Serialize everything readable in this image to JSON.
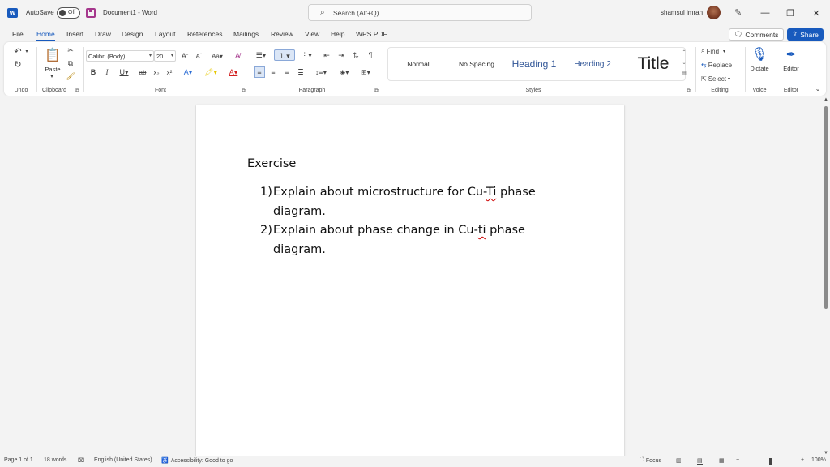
{
  "titlebar": {
    "app_logo": "W",
    "autosave_label": "AutoSave",
    "autosave_state": "Off",
    "document_title": "Document1  -  Word",
    "search_placeholder": "Search (Alt+Q)",
    "user_name": "shamsul imran",
    "minimize": "—",
    "restore": "❐",
    "close": "✕"
  },
  "menu": {
    "tabs": [
      "File",
      "Home",
      "Insert",
      "Draw",
      "Design",
      "Layout",
      "References",
      "Mailings",
      "Review",
      "View",
      "Help",
      "WPS PDF"
    ],
    "active_tab": "Home",
    "comments_label": "Comments",
    "share_label": "Share"
  },
  "ribbon": {
    "groups": {
      "undo": "Undo",
      "clipboard": "Clipboard",
      "font": "Font",
      "paragraph": "Paragraph",
      "styles": "Styles",
      "editing": "Editing",
      "voice": "Voice",
      "editor": "Editor"
    },
    "paste_label": "Paste",
    "font_name": "Calibri (Body)",
    "font_size": "20",
    "styles": [
      "Normal",
      "No Spacing",
      "Heading 1",
      "Heading 2",
      "Title"
    ],
    "find_label": "Find",
    "replace_label": "Replace",
    "select_label": "Select",
    "dictate_label": "Dictate",
    "editor_label": "Editor",
    "style_colors": {
      "heading": "#2f5496",
      "accent": "#185abd"
    }
  },
  "document": {
    "heading": "Exercise",
    "items": [
      {
        "num": "1)",
        "pre": "Explain about microstructure for Cu-",
        "flag": "Ti",
        "post": " phase diagram."
      },
      {
        "num": "2)",
        "pre": "Explain about phase change in Cu-",
        "flag": "ti",
        "post": " phase diagram."
      }
    ]
  },
  "status": {
    "page": "Page 1 of 1",
    "words": "18 words",
    "language": "English (United States)",
    "accessibility": "Accessibility: Good to go",
    "focus": "Focus",
    "zoom": "100%"
  }
}
